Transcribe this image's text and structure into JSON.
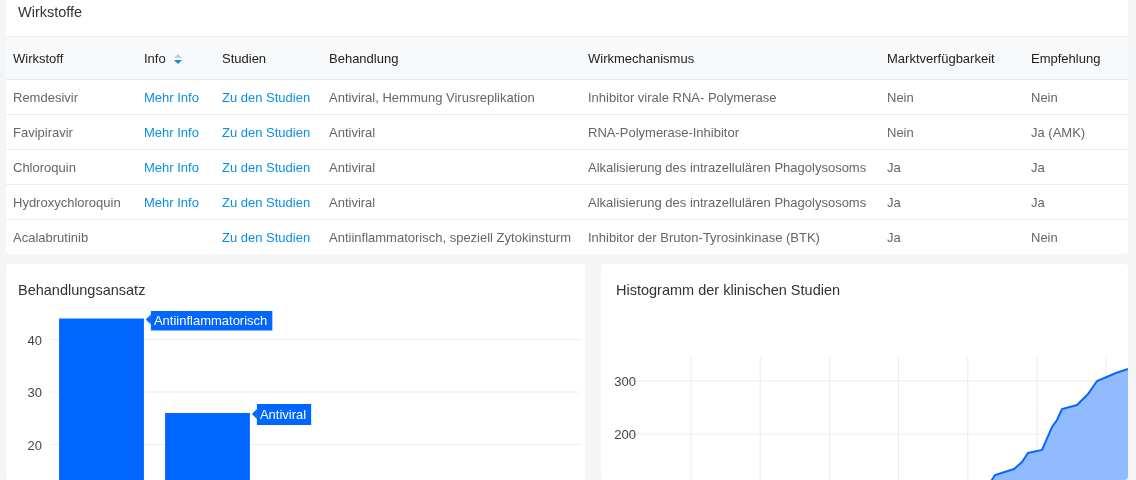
{
  "table": {
    "title": "Wirkstoffe",
    "columns": [
      {
        "label": "Wirkstoff"
      },
      {
        "label": "Info",
        "sort_descending": true
      },
      {
        "label": "Studien"
      },
      {
        "label": "Behandlung"
      },
      {
        "label": "Wirkmechanismus"
      },
      {
        "label": "Marktverfügbarkeit"
      },
      {
        "label": "Empfehlung"
      }
    ],
    "rows": [
      {
        "wirkstoff": "Remdesivir",
        "info_link": "Mehr Info",
        "studien_link": "Zu den Studien",
        "behandlung": "Antiviral, Hemmung Virusreplikation",
        "wirkmechanismus": "Inhibitor virale RNA- Polymerase",
        "marktverfuegbarkeit": "Nein",
        "empfehlung": "Nein"
      },
      {
        "wirkstoff": "Favipiravir",
        "info_link": "Mehr Info",
        "studien_link": "Zu den Studien",
        "behandlung": "Antiviral",
        "wirkmechanismus": "RNA-Polymerase-Inhibitor",
        "marktverfuegbarkeit": "Nein",
        "empfehlung": "Ja (AMK)"
      },
      {
        "wirkstoff": "Chloroquin",
        "info_link": "Mehr Info",
        "studien_link": "Zu den Studien",
        "behandlung": "Antiviral",
        "wirkmechanismus": "Alkalisierung des intrazellulären Phagolysosoms",
        "marktverfuegbarkeit": "Ja",
        "empfehlung": "Ja"
      },
      {
        "wirkstoff": "Hydroxychloroquin",
        "info_link": "Mehr Info",
        "studien_link": "Zu den Studien",
        "behandlung": "Antiviral",
        "wirkmechanismus": "Alkalisierung des intrazellulären Phagolysosoms",
        "marktverfuegbarkeit": "Ja",
        "empfehlung": "Ja"
      },
      {
        "wirkstoff": "Acalabrutinib",
        "studien_link": "Zu den Studien",
        "behandlung": "Antiinflammatorisch, speziell Zytokinsturm",
        "wirkmechanismus": "Inhibitor der Bruton-Tyrosinkinase (BTK)",
        "marktverfuegbarkeit": "Ja",
        "empfehlung": "Nein"
      }
    ]
  },
  "behandlungsansatz": {
    "title": "Behandlungsansatz",
    "chart_data": {
      "type": "bar",
      "categories": [
        null,
        null,
        null,
        null,
        null
      ],
      "values": [
        44,
        26,
        null,
        null,
        null
      ],
      "ylim": [
        12,
        46
      ],
      "yticks": [
        20,
        30,
        40
      ],
      "grid": true,
      "annotations": [
        {
          "text": "Antiinflammatorisch"
        },
        {
          "text": "Antiviral"
        }
      ]
    }
  },
  "histogramm": {
    "title": "Histogramm der klinischen Studien",
    "y_axis_labels": [
      "300",
      "200"
    ]
  }
}
